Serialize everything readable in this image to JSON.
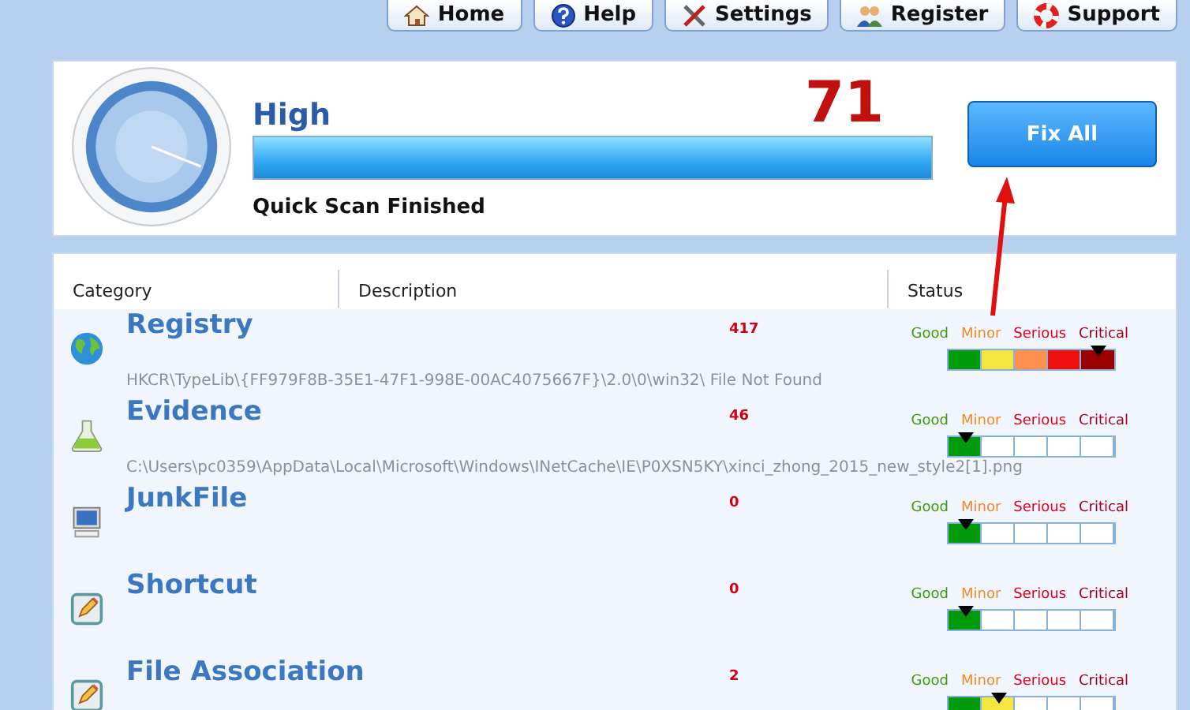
{
  "nav": [
    {
      "label": "Home",
      "kind": "home"
    },
    {
      "label": "Help",
      "kind": "help"
    },
    {
      "label": "Settings",
      "kind": "settings"
    },
    {
      "label": "Register",
      "kind": "register"
    },
    {
      "label": "Support",
      "kind": "support"
    }
  ],
  "summary": {
    "rating": "High",
    "score": "71",
    "level": 1,
    "status": "Quick Scan Finished",
    "button": "Fix All"
  },
  "table": {
    "columns": [
      "Category",
      "Description",
      "Status"
    ],
    "rows": [
      {
        "kind": "globe",
        "name": "Registry",
        "count": "417",
        "detail": "HKCR\\TypeLib\\{FF979F8B-35E1-47F1-998E-00AC4075667F}\\2.0\\0\\win32\\ File Not Found",
        "level": 1,
        "scale": [
          {
            "label": "Good",
            "color": "#3c9a0a"
          },
          {
            "label": "Minor",
            "color": "#f08a24"
          },
          {
            "label": "Serious",
            "color": "#e0001a"
          },
          {
            "label": "Critical",
            "color": "#a0001a"
          }
        ]
      },
      {
        "kind": "flask",
        "name": "Evidence",
        "count": "46",
        "detail": "C:\\Users\\pc0359\\AppData\\Local\\Microsoft\\Windows\\INetCache\\IE\\P0XSN5KY\\xinci_zhong_2015_new_style2[1].png",
        "level": 0.2,
        "scale": [
          {
            "label": "Good",
            "color": "#3c9a0a"
          },
          {
            "label": "Minor",
            "color": "#f08a24"
          },
          {
            "label": "Serious",
            "color": "#e0001a"
          },
          {
            "label": "Critical",
            "color": "#a0001a"
          }
        ]
      },
      {
        "kind": "computer",
        "name": "JunkFile",
        "count": "0",
        "level": 0.2,
        "scale": [
          {
            "label": "Good",
            "color": "#3c9a0a"
          },
          {
            "label": "Minor",
            "color": "#f08a24"
          },
          {
            "label": "Serious",
            "color": "#e0001a"
          },
          {
            "label": "Critical",
            "color": "#a0001a"
          }
        ]
      },
      {
        "kind": "edit",
        "name": "Shortcut",
        "count": "0",
        "level": 0.2,
        "scale": [
          {
            "label": "Good",
            "color": "#3c9a0a"
          },
          {
            "label": "Minor",
            "color": "#f08a24"
          },
          {
            "label": "Serious",
            "color": "#e0001a"
          },
          {
            "label": "Critical",
            "color": "#a0001a"
          }
        ]
      },
      {
        "kind": "edit",
        "name": "File Association",
        "count": "2",
        "level": 0.4,
        "scale": [
          {
            "label": "Good",
            "color": "#3c9a0a"
          },
          {
            "label": "Minor",
            "color": "#f08a24"
          },
          {
            "label": "Serious",
            "color": "#e0001a"
          },
          {
            "label": "Critical",
            "color": "#a0001a"
          }
        ]
      }
    ]
  }
}
